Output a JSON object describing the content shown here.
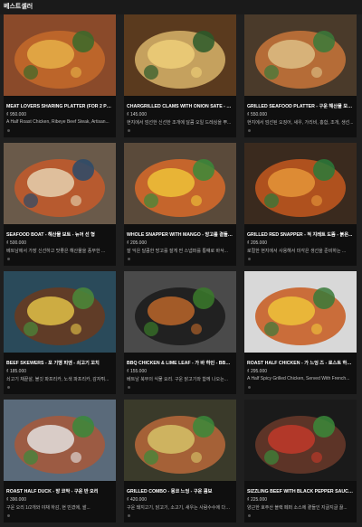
{
  "header": {
    "title": "베스트셀러"
  },
  "items": [
    {
      "title": "MEAT LOVERS SHARING PLATTER (FOR 2 PEOPLE) - 고기...",
      "price": "₫ 950.000",
      "desc": "A Half Roast Chicken, Ribeye Beef Steak, Artisan...",
      "colors": [
        "#8a4a2a",
        "#c46a2a",
        "#e8b44a",
        "#3a6a2a"
      ]
    },
    {
      "title": "CHARGRILLED CLAMS WITH ONION SATE - 양파...",
      "price": "₫ 145.000",
      "desc": "현지에서 엄선한 신선한 조개에 달콤 오일 드레싱을 뿌...",
      "colors": [
        "#5a3a1e",
        "#d8b46a",
        "#f0d27a",
        "#2a5a2a"
      ]
    },
    {
      "title": "GRILLED SEAFOOD PLATTER - 구운 해산물 모듬...",
      "price": "₫ 550.000",
      "desc": "현지에서 엄선된 오징어, 새우, 가리비, 홍합, 조개, 생선...",
      "colors": [
        "#4a3a2a",
        "#c8763a",
        "#e0c48a",
        "#3a7a3a"
      ]
    },
    {
      "title": "SEAFOOD BOAT - 해산물 보트 - 뉴어 선 형",
      "price": "₫ 500.000",
      "desc": "베트남에서 가장 신선하고 맛좋은 해산물을 풍부한 ...",
      "colors": [
        "#6a5a4a",
        "#c45a2a",
        "#e8d8b8",
        "#2a4a6a"
      ]
    },
    {
      "title": "WHOLE SNAPPER WITH MANGO - 망고를 곁들인...",
      "price": "₫ 205.000",
      "desc": "잘 익은 달콤한 망고를 잘게 썬 스냅퍼를 통째로 바삭...",
      "colors": [
        "#5a4a3a",
        "#d86a2a",
        "#f0c83a",
        "#3a8a3a"
      ]
    },
    {
      "title": "GRILLED RED SNAPPER - 적 지레트 도뜸 - 붉은...",
      "price": "₫ 205.000",
      "desc": "로컬한 현지에서 사용해서 미각은 생선을 준비하는 ...",
      "colors": [
        "#3a2a1e",
        "#c4581e",
        "#e89a3a",
        "#2a7a3a"
      ]
    },
    {
      "title": "BEEF SKEWERS - 포 기맹 피엔 - 쇠고기 꼬치",
      "price": "₫ 185.000",
      "desc": "쇠고기 채끝살, 볼깃 파프리카, 노색 파프리카, 감자튀...",
      "colors": [
        "#2a4a5a",
        "#6a3a1e",
        "#e8c84a",
        "#4a8a3a"
      ]
    },
    {
      "title": "BBQ CHICKEN & LIME LEAF - 가 바 하인 - BBQ 치킨...",
      "price": "₫ 155.000",
      "desc": "베트남 북부의 식물 요리. 구운 닭고기와 함께 나오는...",
      "colors": [
        "#4a4a4a",
        "#1a1a1a",
        "#c46a2a",
        "#3a7a2a"
      ]
    },
    {
      "title": "ROAST HALF CHICKEN - 가 느엉 즈 - 로스트 하프 치...",
      "price": "₫ 295.000",
      "desc": "A Half Spicy Grilled Chicken, Served With French...",
      "colors": [
        "#d8d8d8",
        "#c85a1e",
        "#f0c83a",
        "#3a7a3a"
      ]
    },
    {
      "title": "ROAST HALF DUCK - 방 코막 - 구운 반 오리",
      "price": "₫ 390.000",
      "desc": "구운 오리 1/2개와 야채 하감, 현 빈겼에, 쌀...",
      "colors": [
        "#5a6a7a",
        "#a8583a",
        "#e8e8e8",
        "#3a8a3a"
      ]
    },
    {
      "title": "GRILLED COMBO - 몽코 느엉 - 구운 콤보",
      "price": "₫ 420.000",
      "desc": "구운 돼지고기, 닭고기, 소고기, 새우는 사람수수에 다른 세...",
      "colors": [
        "#3a3a2a",
        "#b8683a",
        "#d8c86a",
        "#3a8a3a"
      ]
    },
    {
      "title": "SIZZLING BEEF WITH BLACK PEPPER SAUCE - 후추 ...",
      "price": "₫ 225.000",
      "desc": "양근한 호주산 블랙 페퍼 소스에 곁들인 지글지글 끓...",
      "colors": [
        "#1a1a1a",
        "#6a3a2a",
        "#c83a2a",
        "#3a8a3a"
      ]
    }
  ]
}
